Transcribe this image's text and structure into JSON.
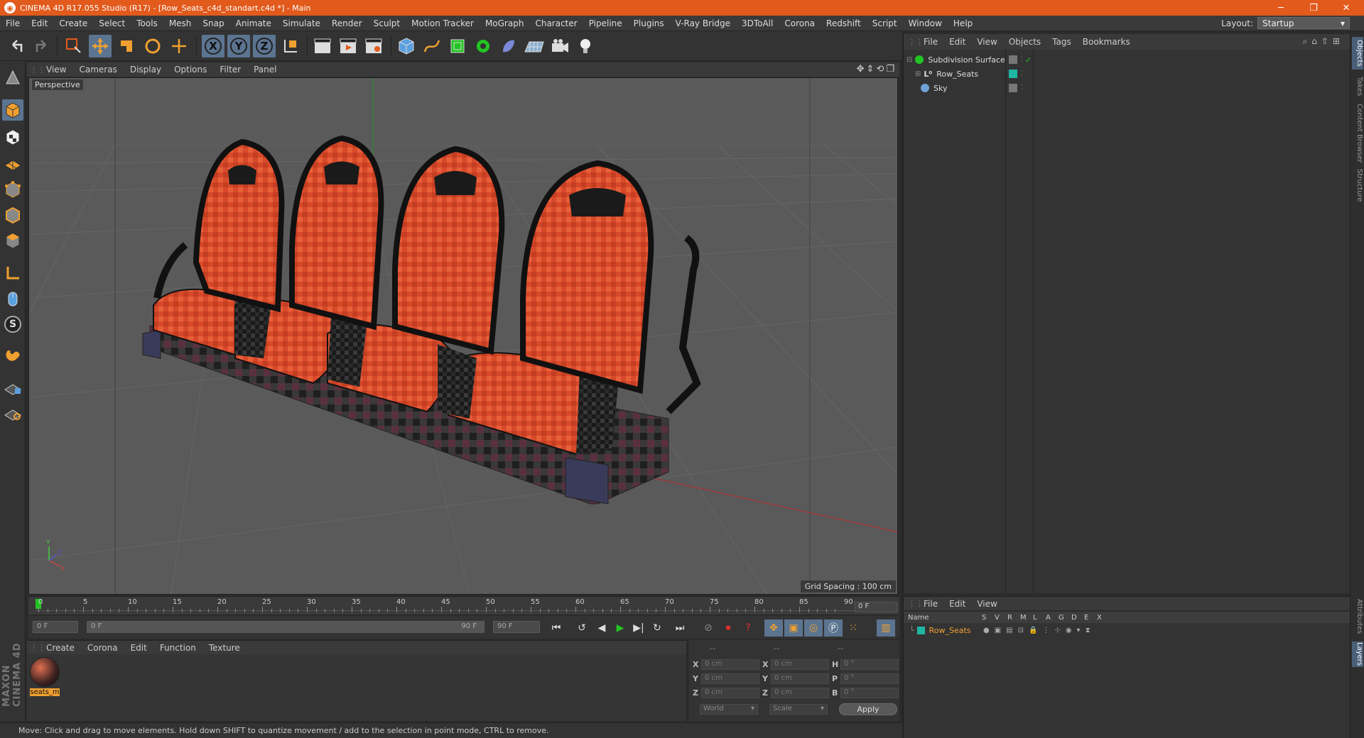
{
  "window": {
    "title": "CINEMA 4D R17.055 Studio (R17) - [Row_Seats_c4d_standart.c4d *] - Main"
  },
  "menu": [
    "File",
    "Edit",
    "Create",
    "Select",
    "Tools",
    "Mesh",
    "Snap",
    "Animate",
    "Simulate",
    "Render",
    "Sculpt",
    "Motion Tracker",
    "MoGraph",
    "Character",
    "Pipeline",
    "Plugins",
    "V-Ray Bridge",
    "3DToAll",
    "Corona",
    "Redshift",
    "Script",
    "Window",
    "Help"
  ],
  "layout": {
    "label": "Layout:",
    "value": "Startup"
  },
  "toolbar": {
    "axis_x": "X",
    "axis_y": "Y",
    "axis_z": "Z"
  },
  "left_tools": {
    "s_label": "S"
  },
  "maxon_logo": "MAXON CINEMA 4D",
  "viewport": {
    "menu": [
      "View",
      "Cameras",
      "Display",
      "Options",
      "Filter",
      "Panel"
    ],
    "label": "Perspective",
    "grid_spacing": "Grid Spacing : 100 cm",
    "axis_y": "Y",
    "axis_z": "Z",
    "axis_x": "X"
  },
  "timeline": {
    "ticks": [
      "0",
      "5",
      "10",
      "15",
      "20",
      "25",
      "30",
      "35",
      "40",
      "45",
      "50",
      "55",
      "60",
      "65",
      "70",
      "75",
      "80",
      "85",
      "90"
    ],
    "current_frame": "0 F"
  },
  "transport": {
    "start": "0 F",
    "range_start": "0 F",
    "range_end": "90 F",
    "end": "90 F"
  },
  "material_manager": {
    "menu": [
      "Create",
      "Corona",
      "Edit",
      "Function",
      "Texture"
    ],
    "material_name": "seats_m"
  },
  "coordinates": {
    "headers": [
      "--",
      "--",
      "--"
    ],
    "rows": [
      {
        "l1": "X",
        "v1": "0 cm",
        "l2": "X",
        "v2": "0 cm",
        "l3": "H",
        "v3": "0 °"
      },
      {
        "l1": "Y",
        "v1": "0 cm",
        "l2": "Y",
        "v2": "0 cm",
        "l3": "P",
        "v3": "0 °"
      },
      {
        "l1": "Z",
        "v1": "0 cm",
        "l2": "Z",
        "v2": "0 cm",
        "l3": "B",
        "v3": "0 °"
      }
    ],
    "mode": "World",
    "transform": "Scale",
    "apply": "Apply"
  },
  "object_manager": {
    "menu": [
      "File",
      "Edit",
      "View",
      "Objects",
      "Tags",
      "Bookmarks"
    ],
    "objects": [
      {
        "name": "Subdivision Surface",
        "color": "#22c522"
      },
      {
        "name": "Row_Seats",
        "color": "#ccc"
      },
      {
        "name": "Sky",
        "color": "#6fa3d6"
      }
    ]
  },
  "layer_manager": {
    "menu": [
      "File",
      "Edit",
      "View"
    ],
    "columns": [
      "Name",
      "S",
      "V",
      "R",
      "M",
      "L",
      "A",
      "G",
      "D",
      "E",
      "X"
    ],
    "layers": [
      {
        "name": "Row_Seats",
        "color": "#1fb5a3"
      }
    ]
  },
  "right_tabs": [
    "Objects",
    "Takes",
    "Content Browser",
    "Structure",
    "Attributes",
    "Layers"
  ],
  "status": "Move: Click and drag to move elements. Hold down SHIFT to quantize movement / add to the selection in point mode, CTRL to remove.",
  "colors": {
    "accent": "#e25a1c",
    "active_tool": "#5b7490",
    "seat_red": "#d94a2a"
  }
}
